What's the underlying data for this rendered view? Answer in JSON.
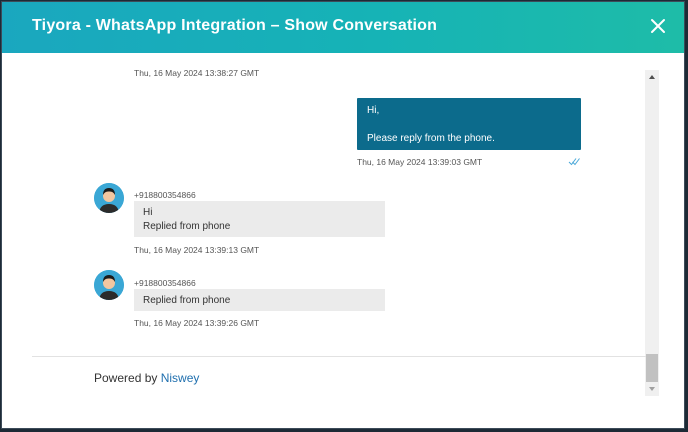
{
  "header": {
    "title": "Tiyora - WhatsApp Integration – Show Conversation",
    "close_icon": "close-icon"
  },
  "messages": [
    {
      "direction": "incoming",
      "timestamp": "Thu, 16 May 2024 13:38:27 GMT"
    },
    {
      "direction": "outgoing",
      "lines": [
        "Hi,",
        "",
        "Please reply from the phone."
      ],
      "timestamp": "Thu, 16 May 2024 13:39:03 GMT",
      "status_icon": "double-check-icon"
    },
    {
      "direction": "incoming",
      "sender": "+918800354866",
      "lines": [
        "Hi",
        "Replied from phone"
      ],
      "timestamp": "Thu, 16 May 2024 13:39:13 GMT"
    },
    {
      "direction": "incoming",
      "sender": "+918800354866",
      "lines": [
        "Replied from phone"
      ],
      "timestamp": "Thu, 16 May 2024 13:39:26 GMT"
    }
  ],
  "footer": {
    "powered_by": "Powered by",
    "brand": "Niswey"
  },
  "colors": {
    "header_start": "#1aa7bf",
    "header_end": "#1ebca8",
    "outgoing_bubble": "#0c6b8c",
    "incoming_bubble": "#ebebeb",
    "link": "#1f6fae"
  }
}
